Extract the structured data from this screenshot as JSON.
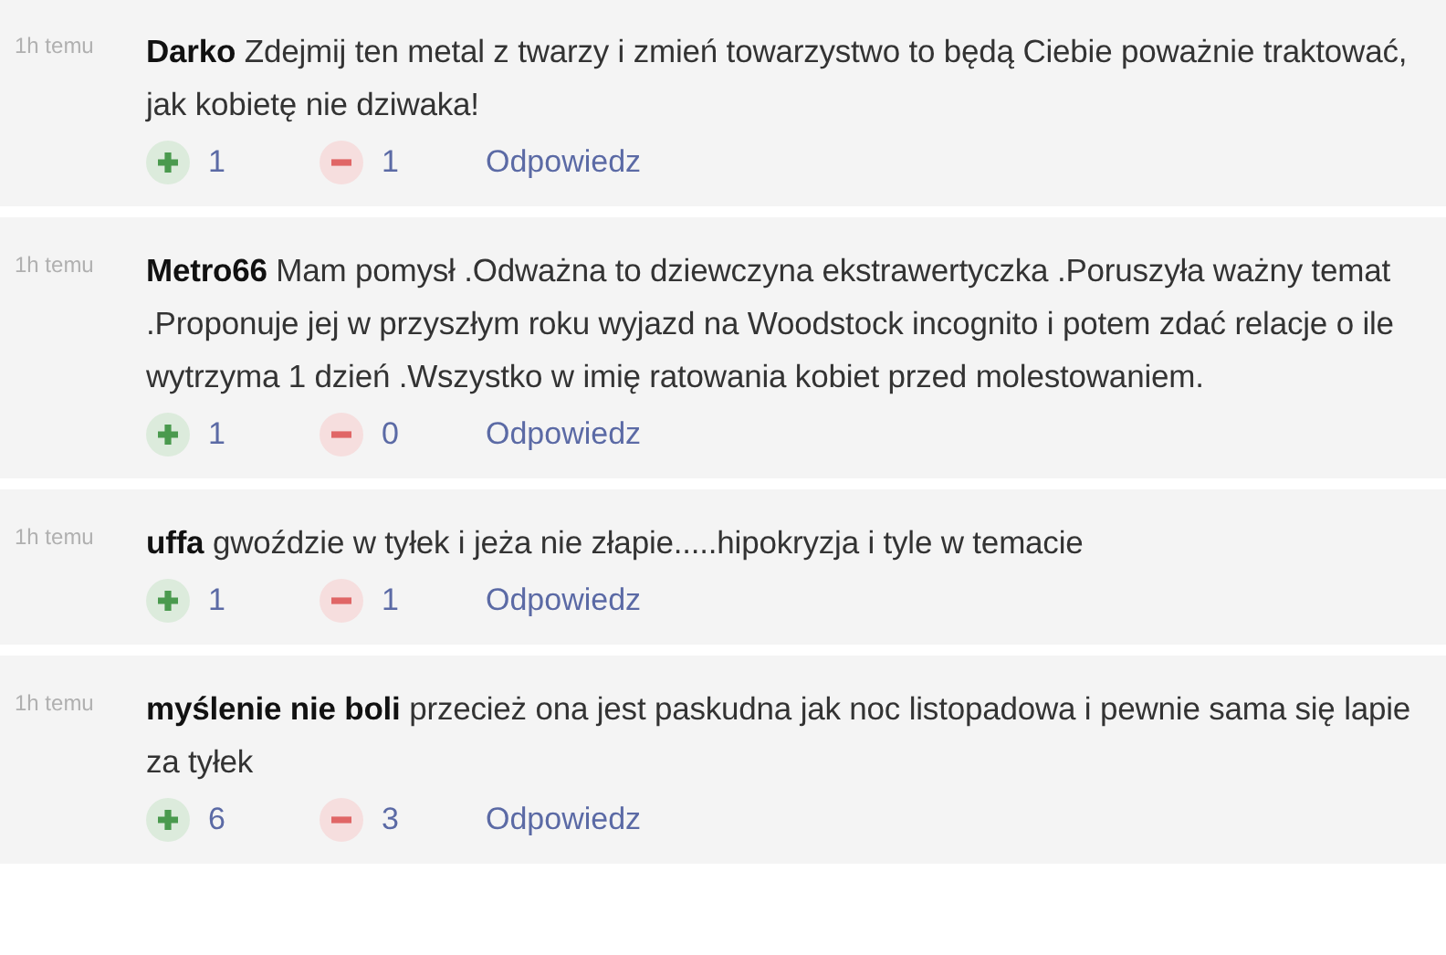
{
  "comments": [
    {
      "time": "1h temu",
      "text": "**Darko** Zdejmij ten metal z twarzy i zmień towarzystwo to będą Ciebie poważnie traktować, jak kobietę nie dziwaka!",
      "upvotes": "1",
      "downvotes": "1",
      "reply": "Odpowiedz"
    },
    {
      "time": "1h temu",
      "text": "**Metro66** Mam pomysł .Odważna to dziewczyna ekstrawertyczka .Poruszyła ważny temat .Proponuje jej w przyszłym roku wyjazd na Woodstock incognito i potem zdać relacje o ile wytrzyma 1 dzień .Wszystko w imię ratowania kobiet przed molestowaniem.",
      "upvotes": "1",
      "downvotes": "0",
      "reply": "Odpowiedz"
    },
    {
      "time": "1h temu",
      "text": "**uffa** gwoździe w tyłek i jeża nie złapie.....hipokryzja i tyle w temacie",
      "upvotes": "1",
      "downvotes": "1",
      "reply": "Odpowiedz"
    },
    {
      "time": "1h temu",
      "text": "**myślenie nie boli** przecież ona jest paskudna jak noc listopadowa i pewnie sama się lapie za tyłek",
      "upvotes": "6",
      "downvotes": "3",
      "reply": "Odpowiedz"
    }
  ]
}
